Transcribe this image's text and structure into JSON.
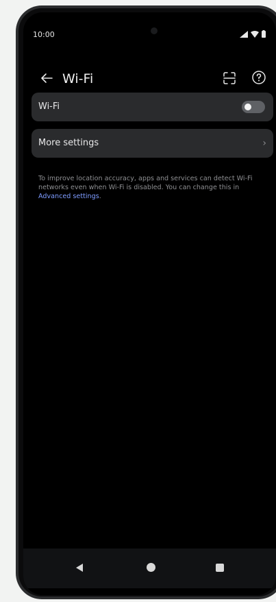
{
  "status_bar": {
    "time": "10:00"
  },
  "app_bar": {
    "title": "Wi-Fi"
  },
  "wifi_card": {
    "label": "Wi-Fi",
    "toggle_on": false
  },
  "more_card": {
    "label": "More settings"
  },
  "info": {
    "text": "To improve location accuracy, apps and services can detect Wi-Fi networks even when Wi-Fi is disabled. You can change this in ",
    "link": "Advanced settings",
    "suffix": "."
  },
  "colors": {
    "accent_link": "#7e9cff",
    "card_bg": "#2a2b2d"
  },
  "icons": [
    "back-arrow-icon",
    "qr-scan-icon",
    "help-icon",
    "signal-icon",
    "wifi-icon",
    "battery-icon",
    "chevron-right-icon"
  ]
}
